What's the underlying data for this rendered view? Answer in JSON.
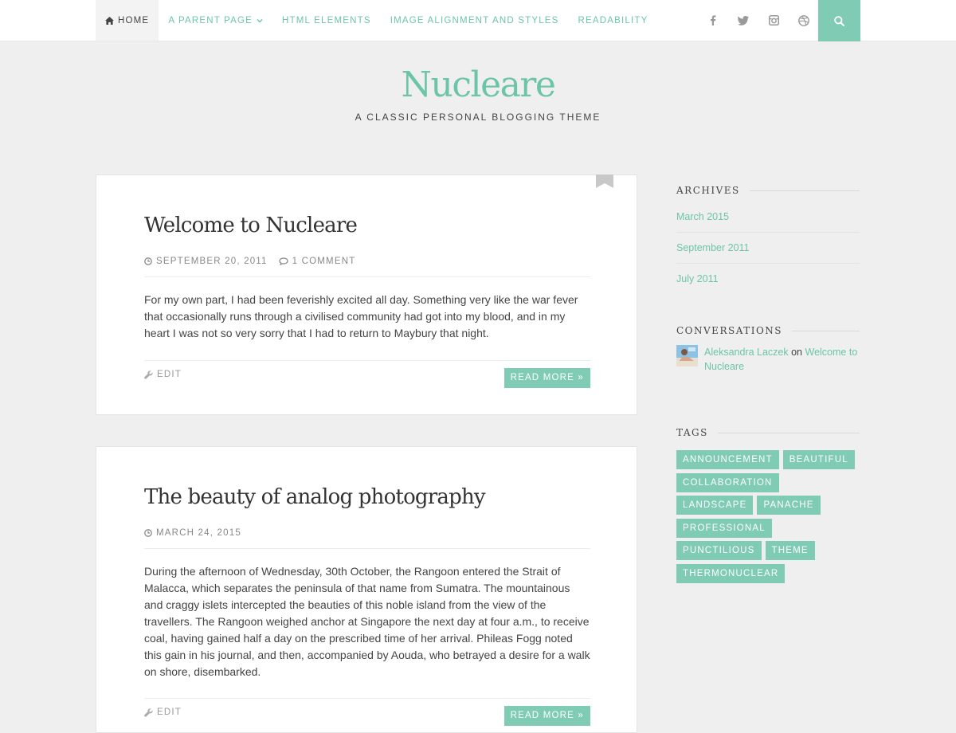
{
  "nav": {
    "items": [
      {
        "label": "Home",
        "icon": "home-icon",
        "active": true
      },
      {
        "label": "A Parent Page",
        "icon": "chevron-down-icon"
      },
      {
        "label": "HTML Elements"
      },
      {
        "label": "Image Alignment and Styles"
      },
      {
        "label": "Readability"
      }
    ],
    "social_icons": [
      "facebook-icon",
      "twitter-icon",
      "instagram-icon",
      "dribbble-icon"
    ],
    "search_icon": "search-icon"
  },
  "site": {
    "title": "Nucleare",
    "tagline": "A Classic Personal Blogging Theme"
  },
  "posts": [
    {
      "title": "Welcome to Nucleare",
      "date": "September 20, 2011",
      "comments": "1 Comment",
      "excerpt": "For my own part, I had been feverishly excited all day. Something very like the war fever that occasionally runs through a civilised community had got into my blood, and in my heart I was not so very sorry that I had to return to Maybury that night.",
      "edit_label": "Edit",
      "read_more": "Read more »"
    },
    {
      "title": "The beauty of analog photography",
      "date": "March 24, 2015",
      "excerpt": "During the afternoon of Wednesday, 30th October, the Rangoon entered the Strait of Malacca, which separates the peninsula of that name from Sumatra. The mountainous and craggy islets intercepted the beauties of this noble island from the view of the travellers. The Rangoon weighed anchor at Singapore the next day at four a.m., to receive coal, having gained half a day on the prescribed time of her arrival. Phileas Fogg noted this gain in his journal, and then, accompanied by Aouda, who betrayed a desire for a walk on shore, disembarked.",
      "edit_label": "Edit",
      "read_more": "Read more »"
    }
  ],
  "sidebar": {
    "archives": {
      "title": "Archives",
      "items": [
        "March 2015",
        "September 2011",
        "July 2011"
      ]
    },
    "conversations": {
      "title": "Conversations",
      "author": "Aleksandra Laczek",
      "on": "on",
      "post": "Welcome to Nucleare"
    },
    "tags": {
      "title": "Tags",
      "items": [
        "Announcement",
        "Beautiful",
        "Collaboration",
        "Landscape",
        "Panache",
        "Professional",
        "Punctilious",
        "Theme",
        "Thermonuclear"
      ]
    }
  },
  "colors": {
    "accent": "#6cc5a8",
    "accent_bg": "#7fcbb3",
    "page_bg": "#efefef"
  }
}
